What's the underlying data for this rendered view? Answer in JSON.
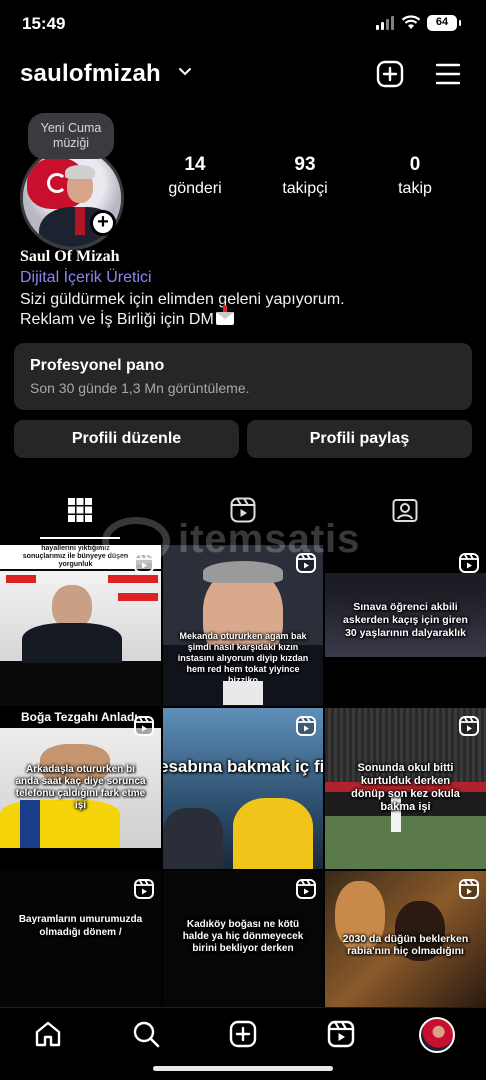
{
  "status_bar": {
    "time": "15:49",
    "battery": "64"
  },
  "header": {
    "username": "saulofmizah"
  },
  "profile": {
    "note": "Yeni Cuma müziği",
    "stats": [
      {
        "value": "14",
        "label": "gönderi"
      },
      {
        "value": "93",
        "label": "takipçi"
      },
      {
        "value": "0",
        "label": "takip"
      }
    ],
    "name": "Saul Of Mizah",
    "category": "Dijital İçerik Üretici",
    "bio_line1": "Sizi güldürmek için elimden geleni yapıyorum.",
    "bio_line2": "Reklam ve İş Birliği için DM"
  },
  "dashboard": {
    "title": "Profesyonel pano",
    "subtitle": "Son 30 günde 1,3 Mn görüntüleme."
  },
  "buttons": {
    "edit": "Profili düzenle",
    "share": "Profili paylaş"
  },
  "watermark": "itemsatis",
  "posts": [
    {
      "top_text": "hayallerini yıktığımız sonuçlarımız ile bünyeye düşen yorgunluk",
      "caption": ""
    },
    {
      "top_text": "",
      "caption": "Mekanda otururken agam bak şimdi nasıl karşıdaki kızın instasını alıyorum diyip kızdan hem red hem tokat yiyince bizziko"
    },
    {
      "top_text": "",
      "caption": "Sınava öğrenci akbili askerden kaçış için giren 30 yaşlarının dalyaraklık"
    },
    {
      "top_text": "Boğa Tezgahı Anladı",
      "caption": "Arkadaşla otururken bi anda saat kaç diye sorunca telefonu çaldığını fark etme işi"
    },
    {
      "top_text": "",
      "caption": "esabına bakmak iç filine girince taki yazısını görünce"
    },
    {
      "top_text": "",
      "caption": "Sonunda okul bitti kurtulduk derken dönüp son kez okula bakma işi"
    },
    {
      "top_text": "",
      "caption": "Bayramların umurumuzda olmadığı dönem /"
    },
    {
      "top_text": "",
      "caption": "Kadıköy boğası ne kötü halde ya hiç dönmeyecek birini bekliyor derken"
    },
    {
      "top_text": "",
      "caption": "2030 da düğün beklerken rabia'nın hiç olmadığını"
    }
  ]
}
